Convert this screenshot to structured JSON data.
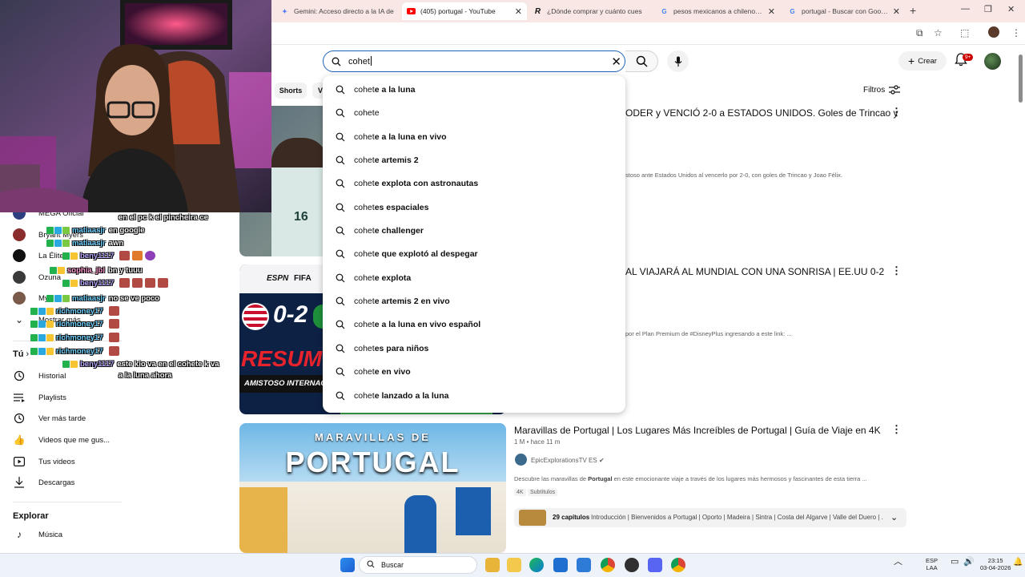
{
  "browser": {
    "tabs": [
      {
        "label": "Gemini: Acceso directo a la IA de",
        "favicon": "gemini-icon",
        "active": false
      },
      {
        "label": "(405) portugal - YouTube",
        "favicon": "youtube-icon",
        "active": true
      },
      {
        "label": "¿Dónde comprar y cuánto cues",
        "favicon": "r-icon",
        "active": false
      },
      {
        "label": "pesos mexicanos a chilenos - B",
        "favicon": "google-icon",
        "active": false
      },
      {
        "label": "portugal - Buscar con Google",
        "favicon": "google-icon",
        "active": false
      }
    ],
    "new_tab_label": "+"
  },
  "youtube": {
    "search": {
      "value": "cohet",
      "placeholder": "Buscar"
    },
    "create_label": "Crear",
    "notifications_badge": "9+",
    "chips": [
      "Shorts",
      "V"
    ],
    "filters_label": "Filtros",
    "suggestions": [
      {
        "query": "cohet",
        "completion": "e a la luna"
      },
      {
        "query": "cohet",
        "completion": "e"
      },
      {
        "query": "cohet",
        "completion": "e a la luna en vivo"
      },
      {
        "query": "cohet",
        "completion": "e artemis 2"
      },
      {
        "query": "cohet",
        "completion": "e explota con astronautas"
      },
      {
        "query": "cohet",
        "completion": "es espaciales"
      },
      {
        "query": "cohet",
        "completion": "e challenger"
      },
      {
        "query": "cohet",
        "completion": "e que explotó al despegar"
      },
      {
        "query": "cohet",
        "completion": "e explota"
      },
      {
        "query": "cohet",
        "completion": "e artemis 2 en vivo"
      },
      {
        "query": "cohet",
        "completion": "e a la luna en vivo español"
      },
      {
        "query": "cohet",
        "completion": "es para niños"
      },
      {
        "query": "cohet",
        "completion": "e en vivo"
      },
      {
        "query": "cohet",
        "completion": "e lanzado a la luna"
      }
    ],
    "videos": [
      {
        "title_visible": "ODER y VENCIÓ 2-0 a ESTADOS UNIDOS. Goles de Trincao y",
        "desc_visible": "stoso ante Estados Unidos al vencerlo por 2-0, con goles de Trincao y Joao Félix."
      },
      {
        "title_visible": "AL VIAJARÁ AL MUNDIAL CON UNA SONRISA | EE.UU 0-2",
        "desc_visible": "por el Plan Premium de #DisneyPlus ingresando a este link: ...",
        "thumb_texts": {
          "brand1": "ESPN",
          "brand2": "FIFA",
          "score": "0-2",
          "resumen": "RESUMEN",
          "amistoso": "AMISTOSO INTERNACIO"
        }
      },
      {
        "title": "Maravillas de Portugal | Los Lugares Más Increíbles de Portugal | Guía de Viaje en 4K",
        "views": "1 M",
        "age": "hace 11 m",
        "views_sep": " • ",
        "channel": "EpicExplorationsTV ES",
        "desc_pre": "Descubre las maravillas de ",
        "desc_bold": "Portugal",
        "desc_post": " en este emocionante viaje a través de los lugares más hermosos y fascinantes de esta tierra ...",
        "tags": [
          "4K",
          "Subtítulos"
        ],
        "chapters_count": "29 capítulos",
        "chapters_text": "Introducción | Bienvenidos a Portugal | Oporto | Madeira | Sintra | Costa del Algarve | Valle del Duero | ...",
        "thumb_top": "MARAVILLAS DE",
        "thumb_main": "PORTUGAL"
      }
    ]
  },
  "sidebar": {
    "channels": [
      {
        "name": "MEGA Oficial"
      },
      {
        "name": "Bryant Myers"
      },
      {
        "name": "La Élite"
      },
      {
        "name": "Ozuna"
      },
      {
        "name": "My"
      }
    ],
    "show_more": "Mostrar más",
    "you_header": "Tú",
    "you_items": [
      {
        "label": "Historial",
        "icon": "history-icon"
      },
      {
        "label": "Playlists",
        "icon": "playlists-icon"
      },
      {
        "label": "Ver más tarde",
        "icon": "watch-later-icon"
      },
      {
        "label": "Videos que me gus...",
        "icon": "liked-icon"
      },
      {
        "label": "Tus videos",
        "icon": "your-videos-icon"
      },
      {
        "label": "Descargas",
        "icon": "downloads-icon"
      }
    ],
    "explore_header": "Explorar",
    "explore_items": [
      {
        "label": "Música",
        "icon": "music-icon"
      }
    ]
  },
  "chat": [
    {
      "user": "",
      "message": "en el pc k el pincheira ce",
      "color": "blue"
    },
    {
      "user": "matiaasjr",
      "message": "en google",
      "color": "blue"
    },
    {
      "user": "matiaasjr",
      "message": "awn",
      "color": "blue"
    },
    {
      "user": "beny1117",
      "message": "",
      "color": "lav",
      "emotes": 3
    },
    {
      "user": "sophia_jbl",
      "message": "bn y tuuu",
      "color": "pink"
    },
    {
      "user": "beny1117",
      "message": "",
      "color": "lav",
      "emotes": 4
    },
    {
      "user": "matiaasjr",
      "message": "no se ve poco",
      "color": "blue"
    },
    {
      "user": "richmoney17",
      "message": "",
      "color": "blue",
      "emotes": 1
    },
    {
      "user": "richmoney17",
      "message": "",
      "color": "blue",
      "emotes": 1
    },
    {
      "user": "richmoney17",
      "message": "",
      "color": "blue",
      "emotes": 1
    },
    {
      "user": "richmoney17",
      "message": "",
      "color": "blue",
      "emotes": 1
    },
    {
      "user": "beny1117",
      "message": "este kio va en el cohete k va",
      "color": "lav"
    },
    {
      "user": "",
      "message": "a la luna ahora",
      "color": "lav"
    }
  ],
  "taskbar": {
    "search_placeholder": "Buscar",
    "language": "ESP",
    "region": "LAA",
    "time": "23:15",
    "date": "03-04-2026"
  },
  "colors": {
    "search_border": "#1c62b9",
    "youtube_red": "#ff0000",
    "tab_strip": "#f9e7e6"
  }
}
